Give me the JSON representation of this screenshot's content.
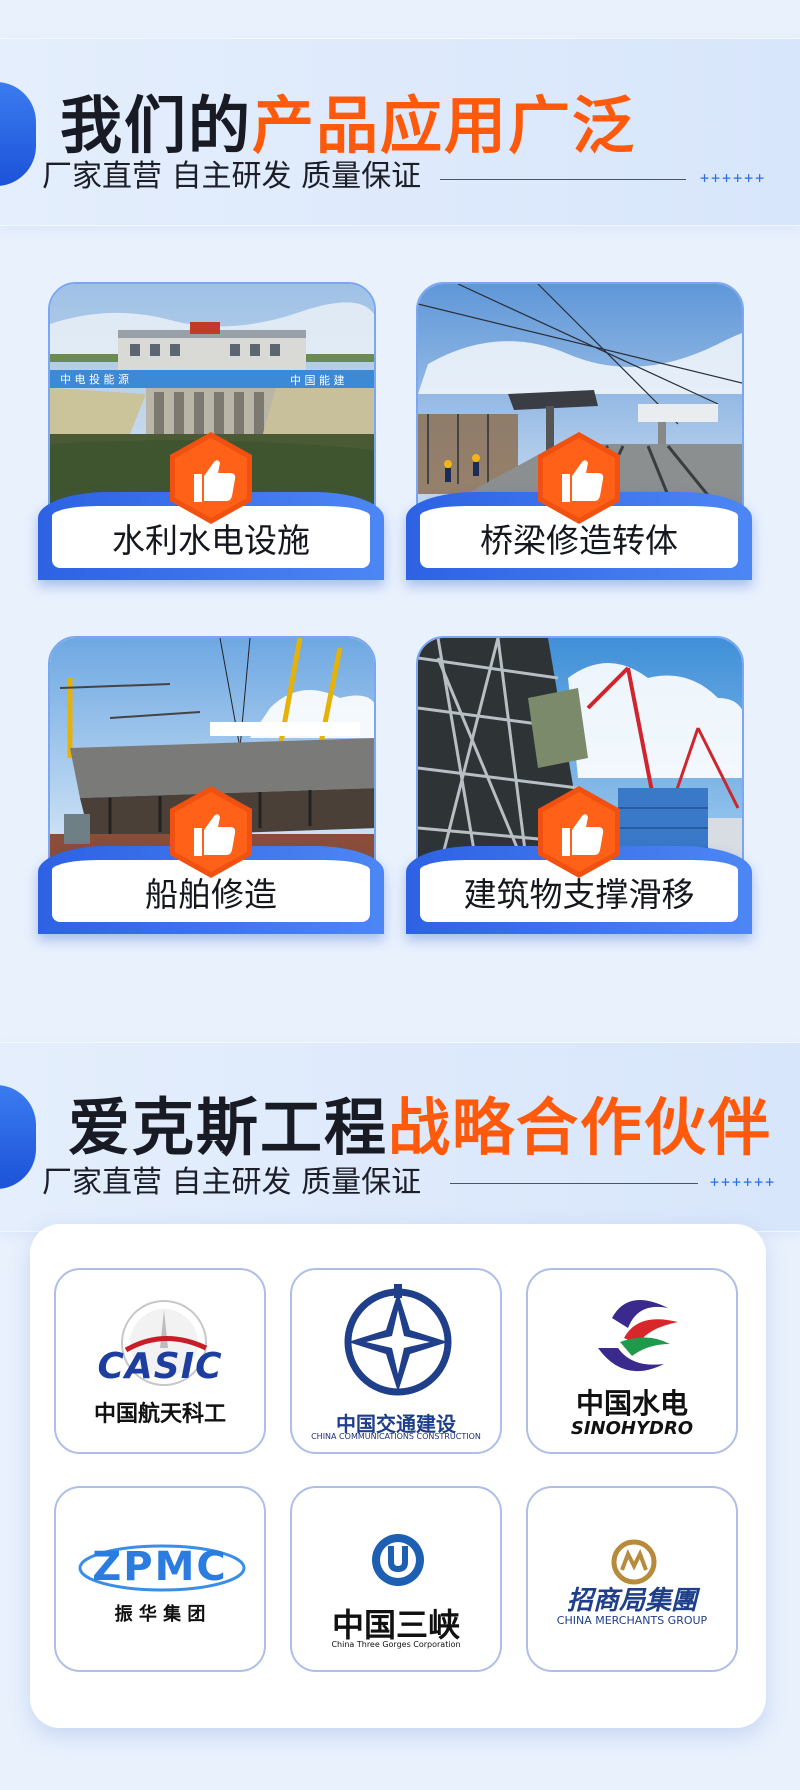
{
  "section1": {
    "title_dark": "我们的",
    "title_orange": "产品应用广泛",
    "subtitle": "厂家直营 自主研发 质量保证",
    "plus_marks": "++++++"
  },
  "applications": [
    {
      "label": "水利水电设施",
      "image": "hydro-dam-photo"
    },
    {
      "label": "桥梁修造转体",
      "image": "bridge-railway-photo"
    },
    {
      "label": "船舶修造",
      "image": "shipyard-photo"
    },
    {
      "label": "建筑物支撑滑移",
      "image": "power-plant-crane-photo"
    }
  ],
  "section2": {
    "title_dark": "爱克斯工程",
    "title_orange": "战略合作伙伴",
    "subtitle": "厂家直营 自主研发 质量保证",
    "plus_marks": "++++++"
  },
  "partners": [
    {
      "mark": "CASIC",
      "name": "中国航天科工",
      "sub": ""
    },
    {
      "mark": "",
      "name": "中国交通建设",
      "sub": "CHINA COMMUNICATIONS CONSTRUCTION"
    },
    {
      "mark": "",
      "name": "中国水电",
      "sub": "SINOHYDRO"
    },
    {
      "mark": "ZPMC",
      "name": "振 华 集 团",
      "sub": ""
    },
    {
      "mark": "",
      "name": "中国三峡",
      "sub": "China Three Gorges Corporation"
    },
    {
      "mark": "",
      "name": "招商局集團",
      "sub": "CHINA MERCHANTS GROUP"
    }
  ],
  "colors": {
    "accent_blue": "#2d62e4",
    "accent_orange": "#ff5a0c",
    "background": "#e9f1fd"
  },
  "icons": {
    "badge": "thumbs-up-icon"
  }
}
